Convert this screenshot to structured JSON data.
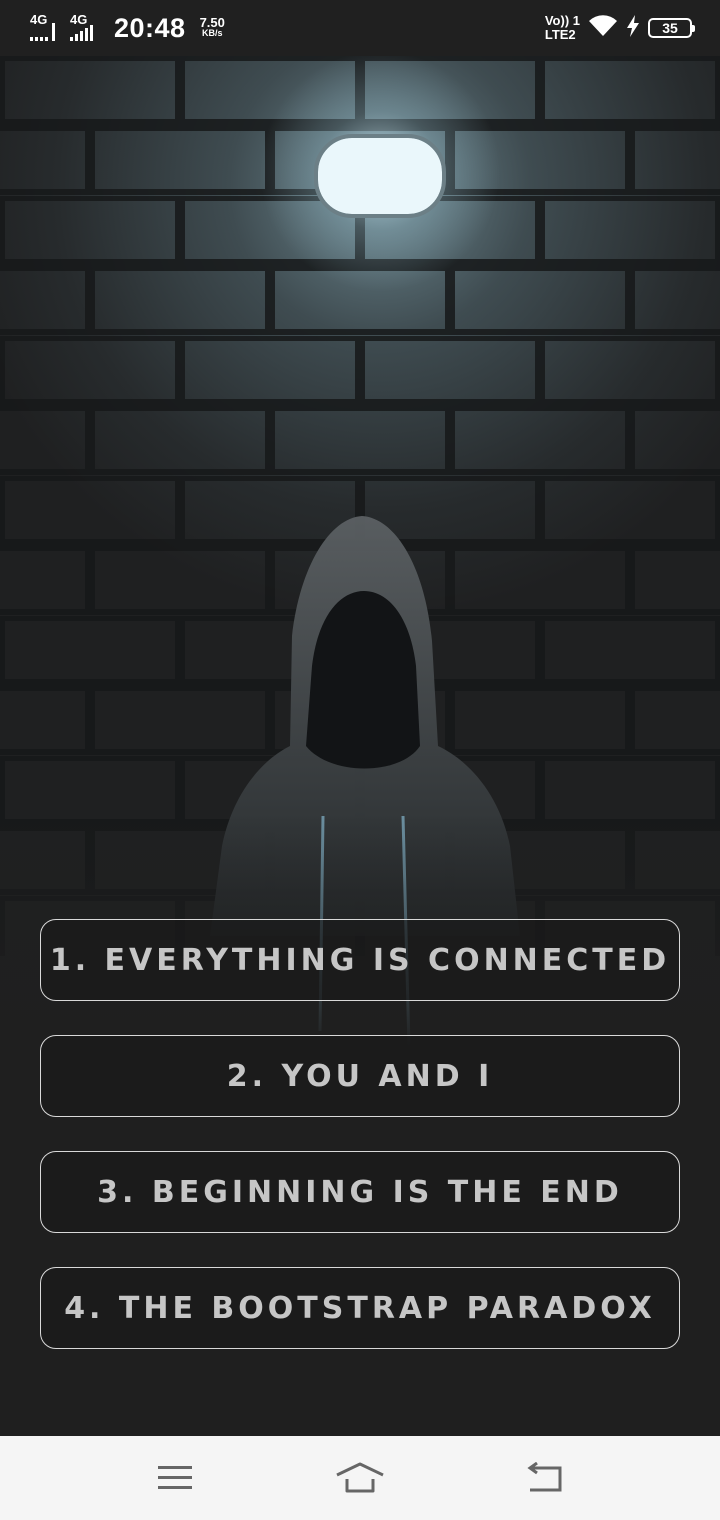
{
  "status_bar": {
    "sim1_network": "4G",
    "sim2_network": "4G",
    "time": "20:48",
    "net_speed_value": "7.50",
    "net_speed_unit": "KB/s",
    "volte_label": "Vo)) 1",
    "lte_label": "LTE2",
    "battery_level": "35",
    "icons": [
      "signal-icon",
      "wifi-icon",
      "charging-bolt-icon",
      "battery-icon"
    ]
  },
  "hero": {
    "description_icon": "hooded-figure-under-lamp-image"
  },
  "menu": {
    "items": [
      {
        "label": "1. EVERYTHING IS CONNECTED"
      },
      {
        "label": "2. YOU AND I"
      },
      {
        "label": "3. BEGINNING IS THE END"
      },
      {
        "label": "4. THE BOOTSTRAP PARADOX"
      }
    ]
  },
  "nav_bar": {
    "icons": [
      "menu-icon",
      "home-icon",
      "back-icon"
    ]
  },
  "colors": {
    "background": "#1f1f1f",
    "button_border": "#d9d9d9",
    "button_text": "#c6c6c6",
    "nav_background": "#f5f5f5",
    "nav_icon": "#666666"
  }
}
